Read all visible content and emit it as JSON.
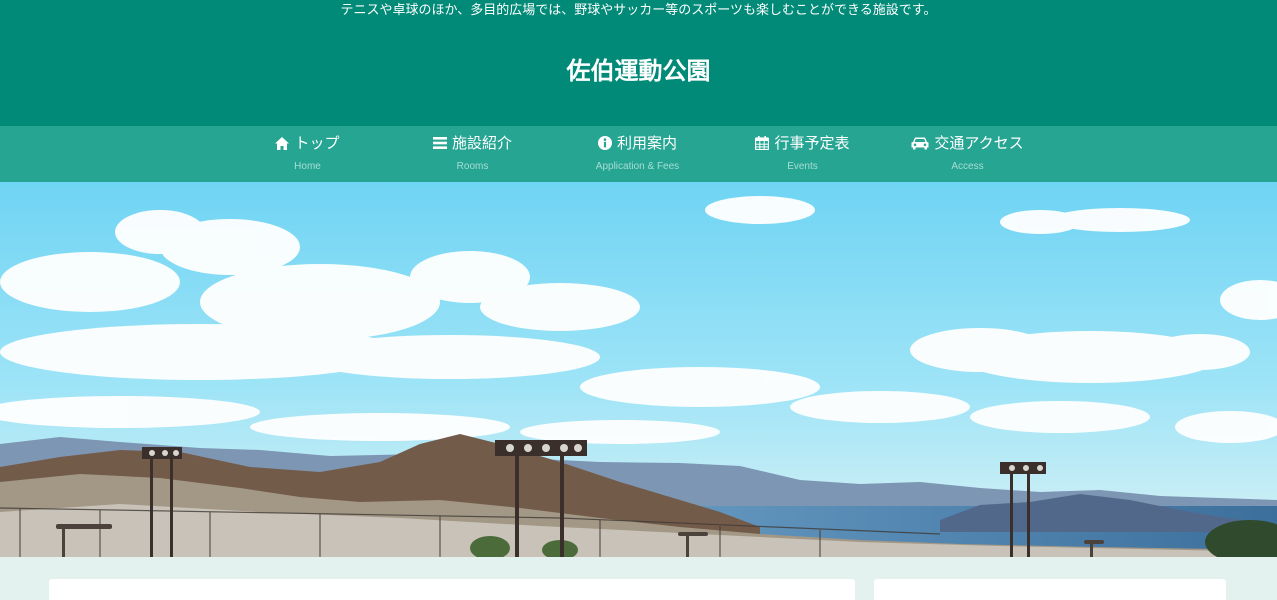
{
  "header": {
    "tagline": "テニスや卓球のほか、多目的広場では、野球やサッカー等のスポーツも楽しむことができる施設です。",
    "site_title": "佐伯運動公園"
  },
  "nav": {
    "items": [
      {
        "label": "トップ",
        "sub": "Home",
        "icon": "home-icon"
      },
      {
        "label": "施設紹介",
        "sub": "Rooms",
        "icon": "list-icon"
      },
      {
        "label": "利用案内",
        "sub": "Application & Fees",
        "icon": "info-icon"
      },
      {
        "label": "行事予定表",
        "sub": "Events",
        "icon": "calendar-icon"
      },
      {
        "label": "交通アクセス",
        "sub": "Access",
        "icon": "car-icon"
      }
    ]
  },
  "hero": {
    "image": "park-landscape-photo"
  },
  "colors": {
    "header_bg": "#008a77",
    "nav_bg": "#26a593",
    "nav_sub_text": "#a8ddd4",
    "page_bg": "#e3f1ef"
  }
}
